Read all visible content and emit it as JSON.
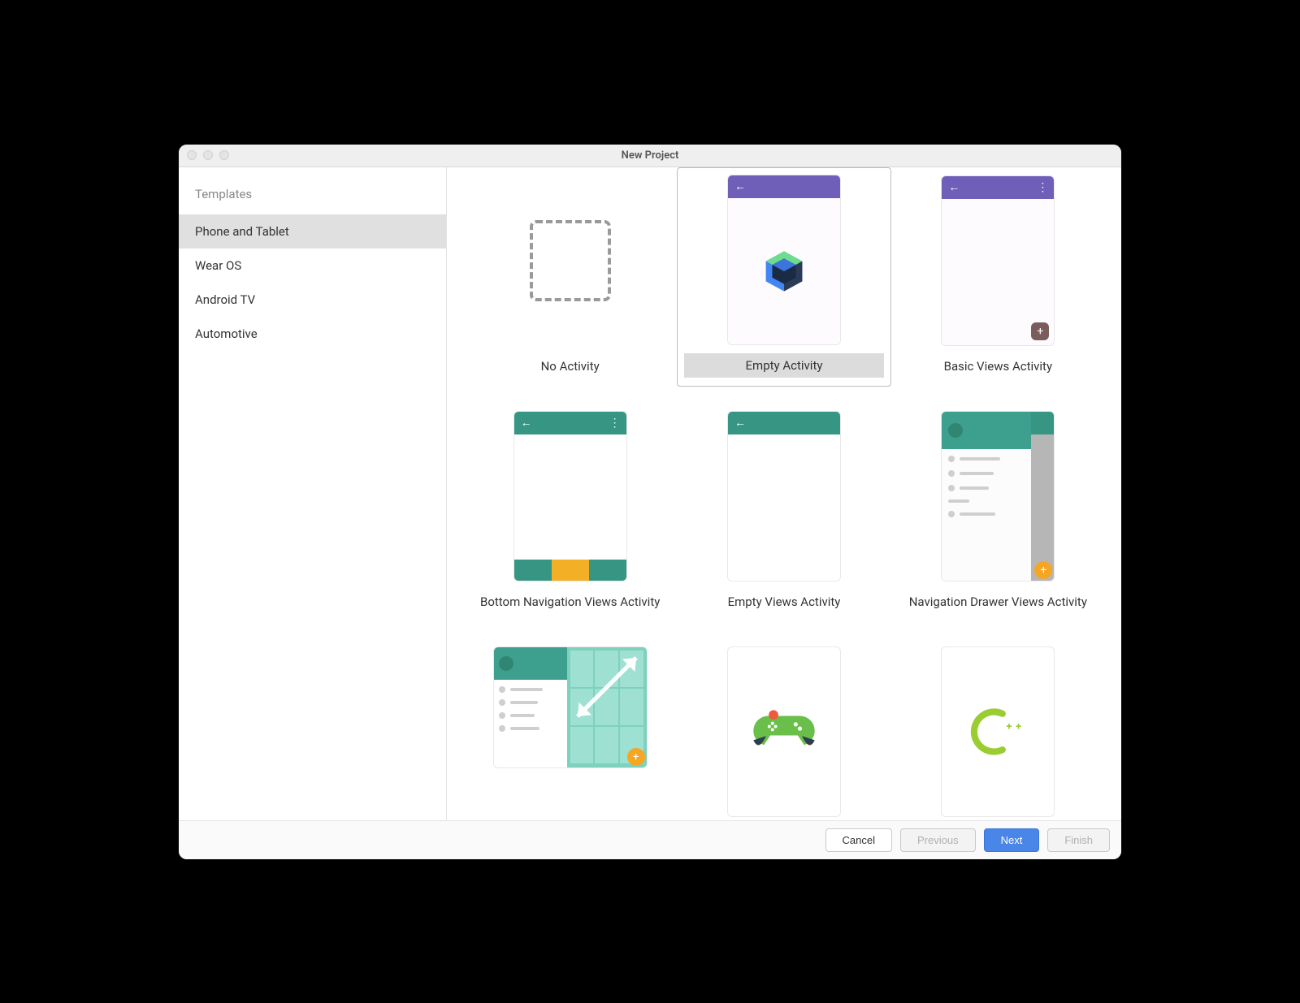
{
  "window": {
    "title": "New Project"
  },
  "sidebar": {
    "title": "Templates",
    "items": [
      {
        "label": "Phone and Tablet",
        "selected": true
      },
      {
        "label": "Wear OS",
        "selected": false
      },
      {
        "label": "Android TV",
        "selected": false
      },
      {
        "label": "Automotive",
        "selected": false
      }
    ]
  },
  "templates": [
    {
      "label": "No Activity",
      "kind": "none",
      "selected": false
    },
    {
      "label": "Empty Activity",
      "kind": "compose",
      "selected": true
    },
    {
      "label": "Basic Views Activity",
      "kind": "basic_views",
      "selected": false
    },
    {
      "label": "Bottom Navigation Views Activity",
      "kind": "bottom_nav",
      "selected": false
    },
    {
      "label": "Empty Views Activity",
      "kind": "empty_views",
      "selected": false
    },
    {
      "label": "Navigation Drawer Views Activity",
      "kind": "nav_drawer",
      "selected": false
    },
    {
      "label": "",
      "kind": "responsive",
      "selected": false
    },
    {
      "label": "",
      "kind": "game",
      "selected": false
    },
    {
      "label": "",
      "kind": "cpp",
      "selected": false
    }
  ],
  "footer": {
    "cancel": "Cancel",
    "previous": "Previous",
    "next": "Next",
    "finish": "Finish"
  }
}
